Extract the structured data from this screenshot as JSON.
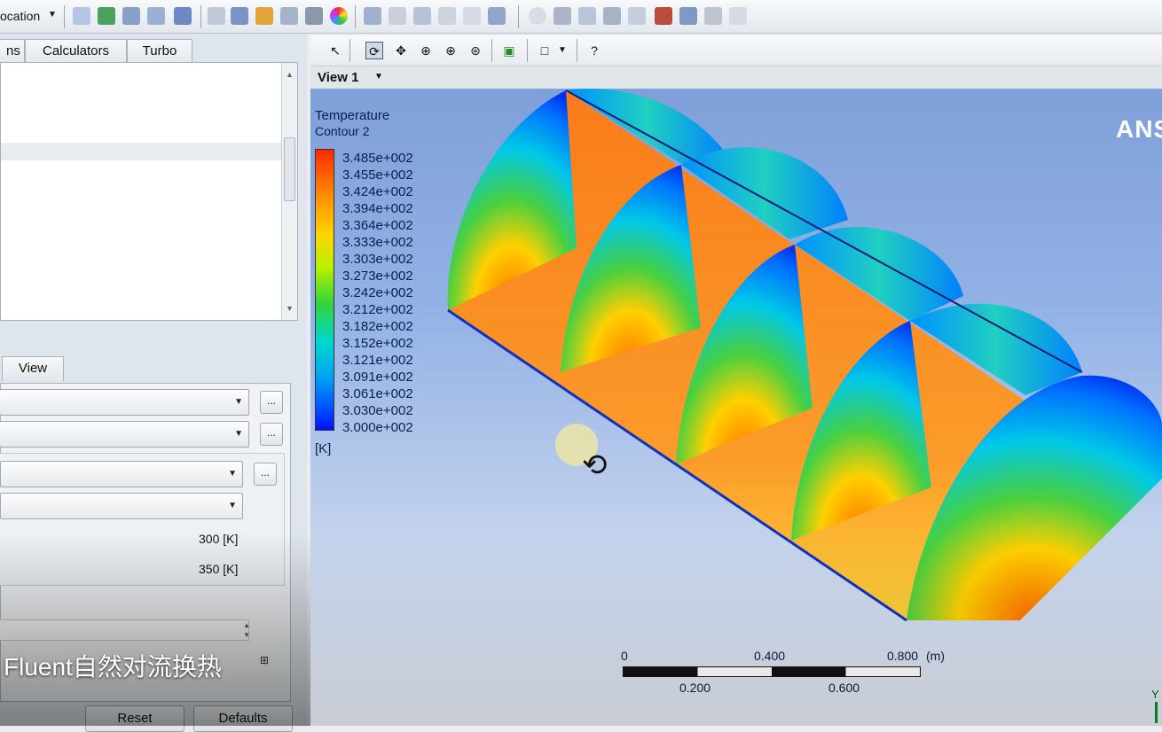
{
  "toolbar": {
    "location_label": "ocation"
  },
  "left_tabs": [
    "ns",
    "Calculators",
    "Turbo"
  ],
  "details_tab": "View",
  "details": {
    "min_value": "300 [K]",
    "max_value": "350 [K]"
  },
  "buttons": {
    "reset": "Reset",
    "defaults": "Defaults"
  },
  "view": {
    "title": "View 1"
  },
  "legend": {
    "title": "Temperature",
    "subtitle": "Contour 2",
    "unit": "[K]",
    "labels": [
      "3.485e+002",
      "3.455e+002",
      "3.424e+002",
      "3.394e+002",
      "3.364e+002",
      "3.333e+002",
      "3.303e+002",
      "3.273e+002",
      "3.242e+002",
      "3.212e+002",
      "3.182e+002",
      "3.152e+002",
      "3.121e+002",
      "3.091e+002",
      "3.061e+002",
      "3.030e+002",
      "3.000e+002"
    ]
  },
  "brand": "ANS",
  "scale": {
    "unit": "(m)",
    "top": [
      "0",
      "0.400",
      "0.800"
    ],
    "bottom": [
      "0.200",
      "0.600"
    ]
  },
  "axis": {
    "y": "Y"
  },
  "subtitle": "Fluent自然对流换热"
}
